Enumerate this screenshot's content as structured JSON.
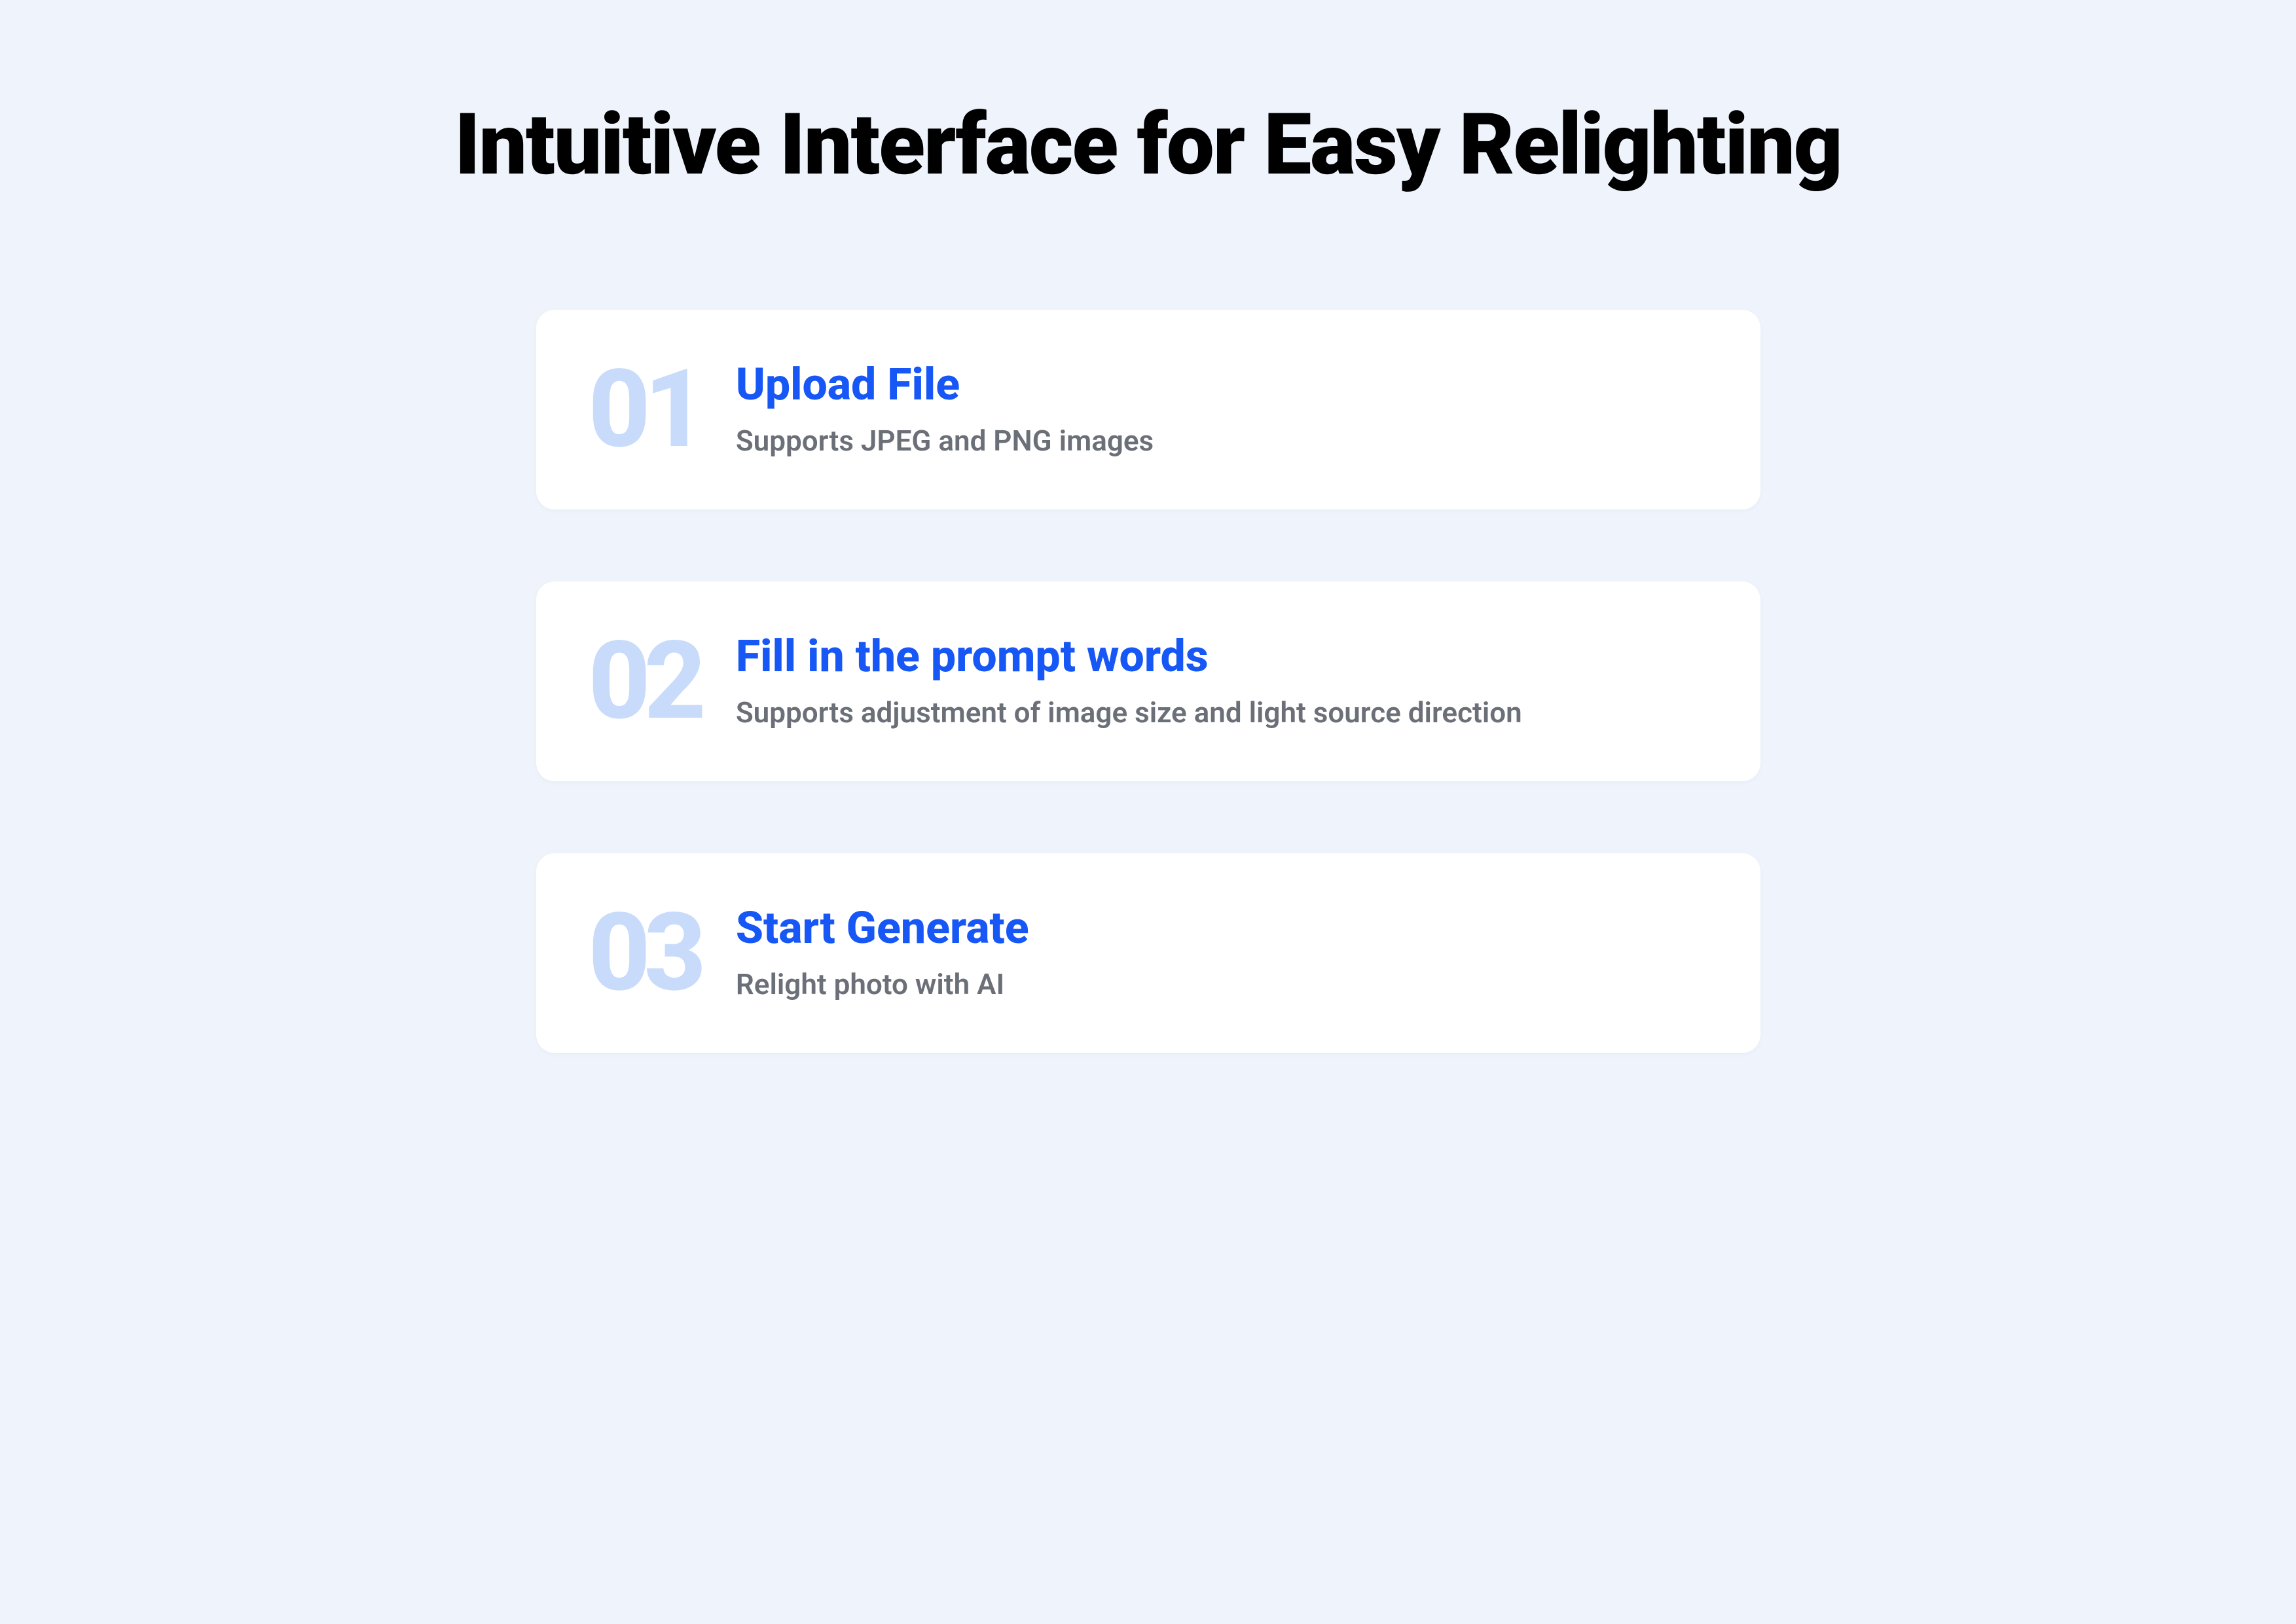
{
  "heading": "Intuitive Interface for Easy Relighting",
  "steps": [
    {
      "number": "01",
      "title": "Upload File",
      "desc": "Supports JPEG and PNG images"
    },
    {
      "number": "02",
      "title": "Fill in the prompt words",
      "desc": "Supports adjustment of image size and light source direction"
    },
    {
      "number": "03",
      "title": "Start  Generate",
      "desc": "Relight photo with AI"
    }
  ]
}
